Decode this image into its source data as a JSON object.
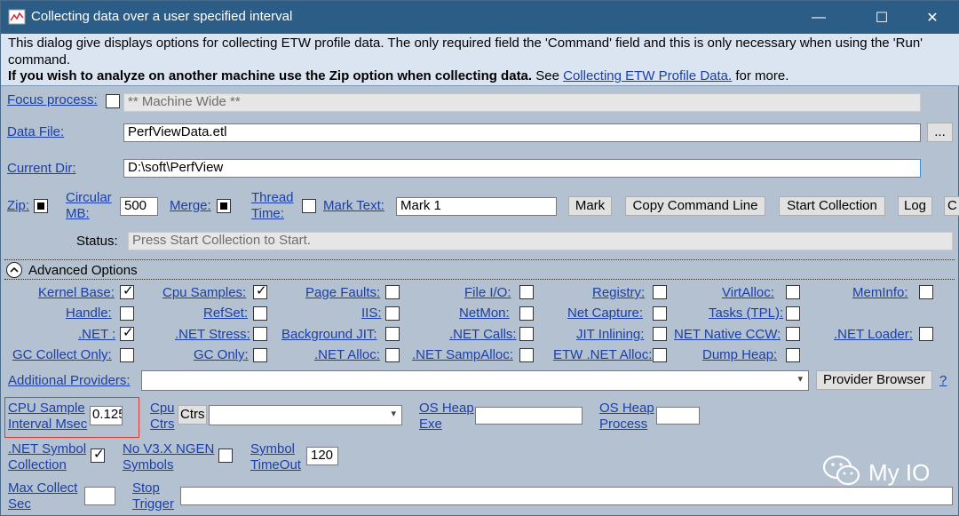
{
  "window": {
    "title": "Collecting data over a user specified interval",
    "minimize_glyph": "—",
    "maximize_glyph": "☐",
    "close_glyph": "✕"
  },
  "info": {
    "line1": "This dialog give displays options for collecting ETW profile data. The only required field the 'Command' field and this is only necessary when using the 'Run' command.",
    "line2_bold": "If you wish to analyze on another machine use the Zip option when collecting data.",
    "line2_see": " See ",
    "line2_link": "Collecting ETW Profile Data.",
    "line2_tail": " for more."
  },
  "form": {
    "focus_process": {
      "label": "Focus process:",
      "value": "** Machine Wide **"
    },
    "data_file": {
      "label": "Data File:",
      "value": "PerfViewData.etl",
      "browse": "..."
    },
    "current_dir": {
      "label": "Current Dir:",
      "value": "D:\\soft\\PerfView"
    },
    "zip_label": "Zip:",
    "circular_l1": "Circular",
    "circular_l2": "MB:",
    "circular_value": "500",
    "merge_label": "Merge:",
    "thread_l1": "Thread",
    "thread_l2": "Time:",
    "mark_text_label": "Mark Text:",
    "mark_text_value": "Mark 1",
    "buttons": {
      "mark": "Mark",
      "copy_cmd": "Copy Command Line",
      "start": "Start Collection",
      "log": "Log",
      "cancel_partial": "C"
    },
    "status_label": "Status:",
    "status_value": "Press Start Collection to Start."
  },
  "advanced": {
    "header": "Advanced Options",
    "row1": [
      {
        "label": "Kernel Base:",
        "checked": true
      },
      {
        "label": "Cpu Samples:",
        "checked": true
      },
      {
        "label": "Page Faults:",
        "checked": false
      },
      {
        "label": "File I/O:",
        "checked": false
      },
      {
        "label": "Registry:",
        "checked": false
      },
      {
        "label": "VirtAlloc:",
        "checked": false
      },
      {
        "label": "MemInfo:",
        "checked": false
      }
    ],
    "row2": [
      {
        "label": "Handle:",
        "checked": false
      },
      {
        "label": "RefSet:",
        "checked": false
      },
      {
        "label": "IIS:",
        "checked": false
      },
      {
        "label": "NetMon:",
        "checked": false
      },
      {
        "label": "Net Capture:",
        "checked": false
      },
      {
        "label": "Tasks (TPL):",
        "checked": false
      }
    ],
    "row3": [
      {
        "label": ".NET :",
        "checked": true
      },
      {
        "label": ".NET Stress:",
        "checked": false
      },
      {
        "label": "Background JIT:",
        "checked": false
      },
      {
        "label": ".NET Calls:",
        "checked": false
      },
      {
        "label": "JIT Inlining:",
        "checked": false
      },
      {
        "label": "NET Native CCW:",
        "checked": false
      },
      {
        "label": ".NET Loader:",
        "checked": false
      }
    ],
    "row4": [
      {
        "label": "GC Collect Only:",
        "checked": false
      },
      {
        "label": "GC Only:",
        "checked": false
      },
      {
        "label": ".NET Alloc:",
        "checked": false
      },
      {
        "label": ".NET SampAlloc:",
        "checked": false
      },
      {
        "label": "ETW .NET Alloc:",
        "checked": false
      },
      {
        "label": "Dump Heap:",
        "checked": false
      }
    ],
    "additional_providers": {
      "label": "Additional Providers:",
      "value": "",
      "button": "Provider Browser",
      "help": "?"
    },
    "cpu_sample_l1": "CPU Sample",
    "cpu_sample_l2": "Interval Msec",
    "cpu_sample_value": "0.125",
    "cpu_ctrs_l1": "Cpu",
    "cpu_ctrs_l2": "Ctrs",
    "ctrs_button": "Ctrs",
    "os_heap_exe_l1": "OS Heap",
    "os_heap_exe_l2": "Exe",
    "os_heap_proc_l1": "OS Heap",
    "os_heap_proc_l2": "Process",
    "net_symbol_l1": ".NET Symbol",
    "net_symbol_l2": "Collection",
    "net_symbol_checked": true,
    "no_v3x_l1": "No V3.X NGEN",
    "no_v3x_l2": "Symbols",
    "symbol_timeout_l1": "Symbol",
    "symbol_timeout_l2": "TimeOut",
    "symbol_timeout_value": "120",
    "max_collect_l1": "Max Collect",
    "max_collect_l2": "Sec",
    "stop_trigger_l1": "Stop",
    "stop_trigger_l2": "Trigger"
  },
  "watermark": "My IO"
}
